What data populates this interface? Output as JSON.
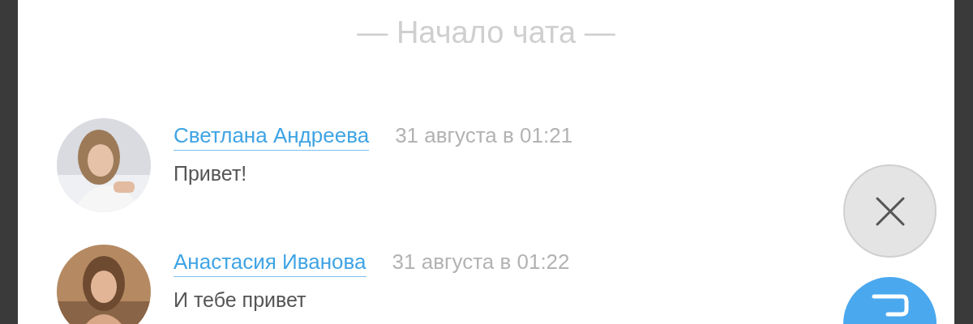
{
  "chat_start": "— Начало чата —",
  "messages": [
    {
      "author": "Светлана Андреева",
      "time": "31 августа в 01:21",
      "text": "Привет!"
    },
    {
      "author": "Анастасия Иванова",
      "time": "31 августа в 01:22",
      "text": "И тебе привет"
    }
  ]
}
